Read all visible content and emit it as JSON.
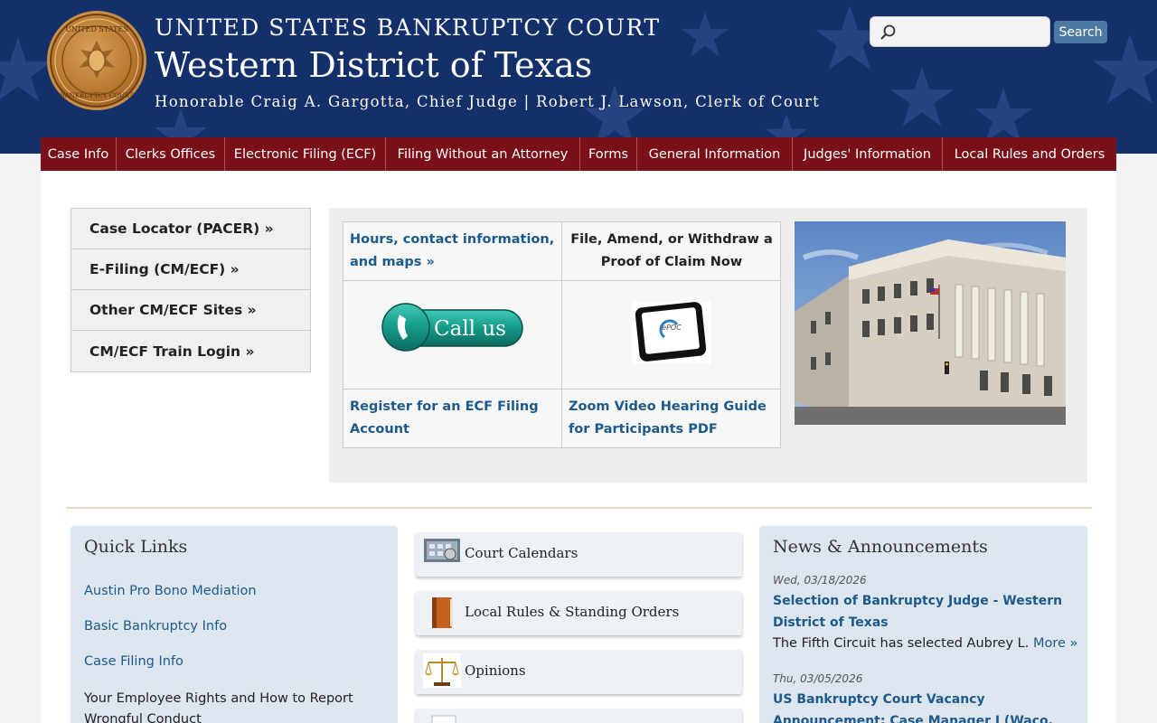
{
  "header": {
    "line1": "UNITED STATES BANKRUPTCY COURT",
    "line2": "Western District of Texas",
    "line3": "Honorable Craig A. Gargotta, Chief Judge | Robert J. Lawson, Clerk of Court",
    "search_placeholder": "",
    "search_button": "Search"
  },
  "nav": {
    "items": [
      {
        "label": "Case Info"
      },
      {
        "label": "Clerks Offices"
      },
      {
        "label": "Electronic Filing (ECF)"
      },
      {
        "label": "Filing Without an Attorney"
      },
      {
        "label": "Forms"
      },
      {
        "label": "General Information"
      },
      {
        "label": "Judges' Information"
      },
      {
        "label": "Local Rules and Orders"
      }
    ]
  },
  "side_menu": {
    "items": [
      {
        "label": "Case Locator (PACER) »"
      },
      {
        "label": "E-Filing (CM/ECF) »"
      },
      {
        "label": "Other CM/ECF Sites »"
      },
      {
        "label": "CM/ECF Train Login »"
      }
    ]
  },
  "feature": {
    "hours": "Hours, contact information, and maps »",
    "claim": "File, Amend, or Withdraw a Proof of Claim Now",
    "callus": "Call us",
    "epoc": "ePOC",
    "register": "Register for an ECF Filing Account",
    "zoom": "Zoom Video Hearing Guide for Participants PDF"
  },
  "quick_links": {
    "title": "Quick Links",
    "links": [
      {
        "label": "Austin Pro Bono Mediation"
      },
      {
        "label": "Basic Bankruptcy Info"
      },
      {
        "label": "Case Filing Info"
      }
    ],
    "text": "Your Employee Rights and How to Report Wrongful Conduct"
  },
  "tiles": [
    {
      "label": "Court Calendars"
    },
    {
      "label": "Local Rules & Standing Orders"
    },
    {
      "label": "Opinions"
    }
  ],
  "news": {
    "title": "News & Announcements",
    "items": [
      {
        "date": "Wed, 03/18/2026",
        "title": "Selection of Bankruptcy Judge - Western District of Texas",
        "body": "The Fifth Circuit has selected Aubrey L.",
        "more": "More »"
      },
      {
        "date": "Thu, 03/05/2026",
        "title": "US Bankruptcy Court Vacancy Announcement: Case Manager I (Waco, Texas)"
      }
    ]
  },
  "colors": {
    "header_bg": "#14306b",
    "nav_bg": "#7a0f17",
    "link": "#1d5a8c",
    "panel_bg": "#dde5ef"
  }
}
